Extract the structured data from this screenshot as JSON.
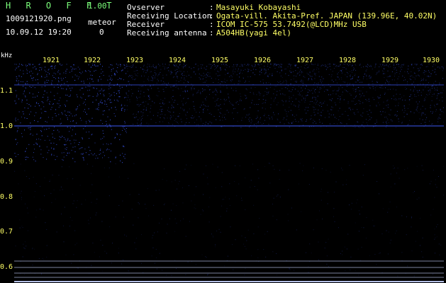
{
  "header": {
    "app_title": "H R O F F T",
    "app_version": "1.00",
    "file_name": "1009121920.png",
    "meteor_label": "meteor",
    "datetime": "10.09.12 19:20",
    "meteor_count": "0"
  },
  "info": [
    {
      "label": "Ovserver",
      "value": "Masayuki Kobayashi"
    },
    {
      "label": "Receiving Location",
      "value": "Ogata-vill. Akita-Pref. JAPAN (139.96E, 40.02N)"
    },
    {
      "label": "Receiver",
      "value": "ICOM IC-575 53.7492(@LCD)MHz USB"
    },
    {
      "label": "Receiving antenna",
      "value": "A504HB(yagi 4el)"
    }
  ],
  "axes": {
    "unit": "kHz",
    "x_ticks": [
      "1921",
      "1922",
      "1923",
      "1924",
      "1925",
      "1926",
      "1927",
      "1928",
      "1929",
      "1930"
    ],
    "y_ticks": [
      "1.1",
      "1.0",
      "0.9",
      "0.8",
      "0.7",
      "0.6"
    ]
  },
  "colors": {
    "text_green": "#7cff7c",
    "text_yellow": "#ffff66",
    "signal_blue": "#3f5cff",
    "background": "#000000"
  }
}
